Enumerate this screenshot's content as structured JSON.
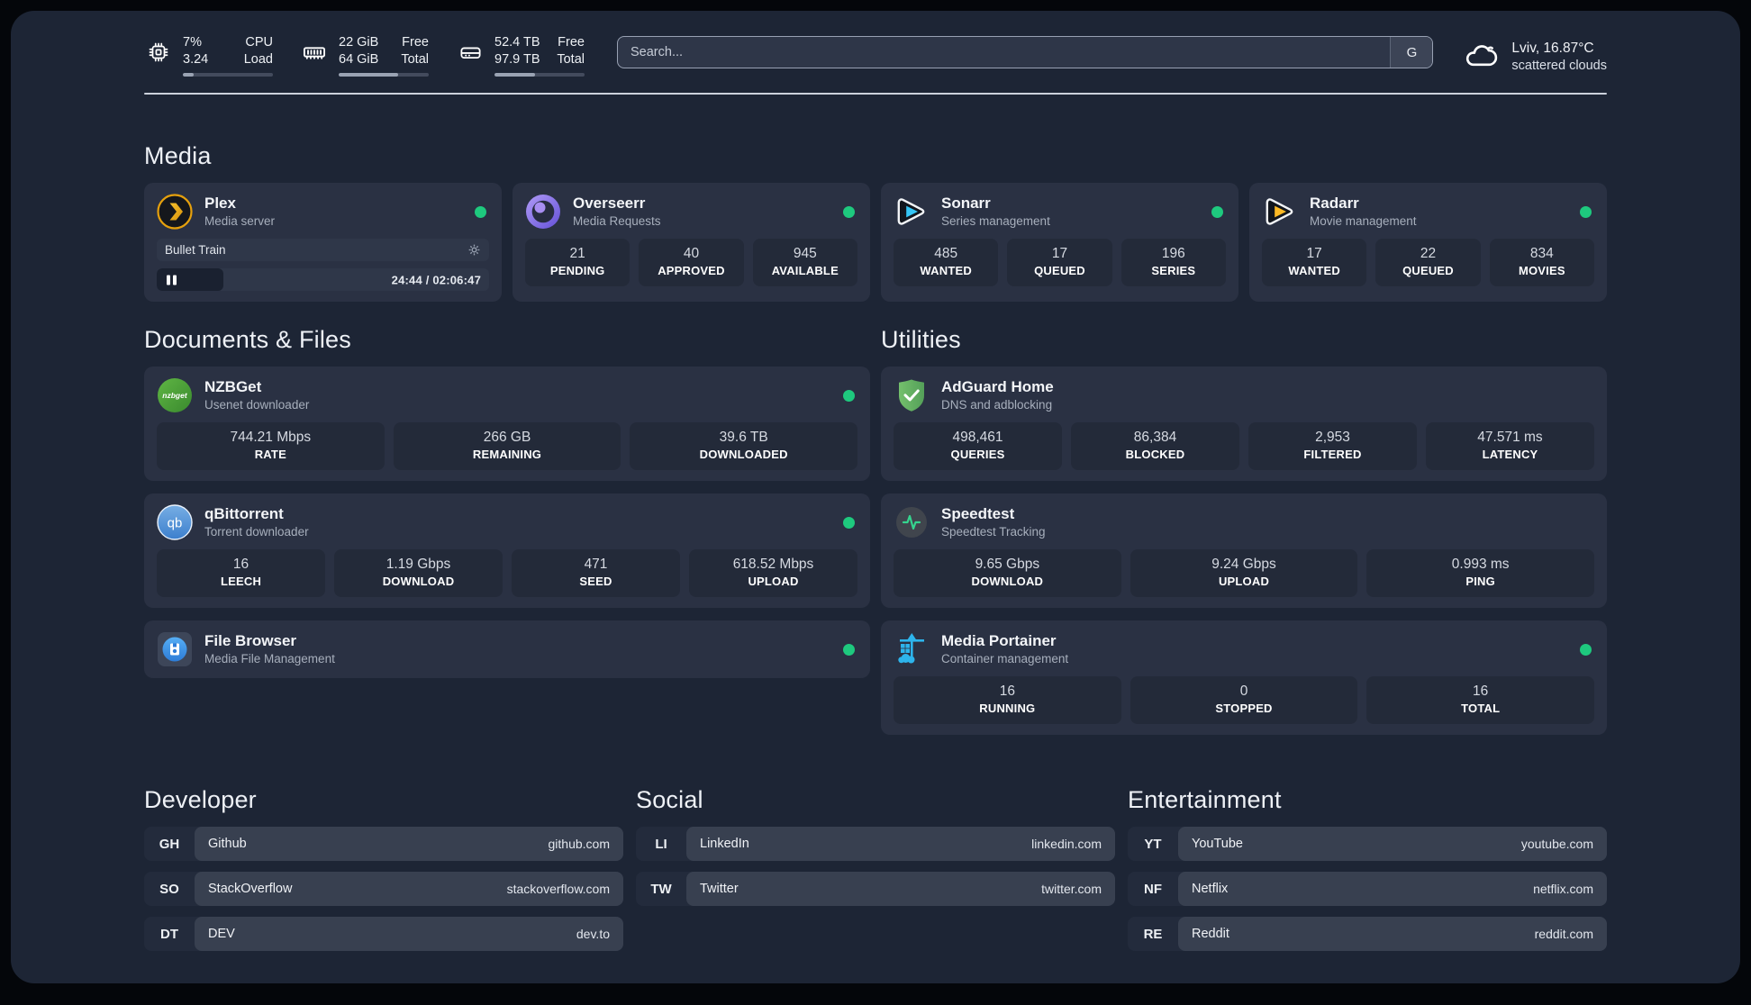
{
  "header": {
    "stats": [
      {
        "id": "cpu",
        "value_top": "7%",
        "value_bottom": "3.24",
        "label_top": "CPU",
        "label_bottom": "Load",
        "progress": "12%"
      },
      {
        "id": "memory",
        "value_top": "22 GiB",
        "value_bottom": "64 GiB",
        "label_top": "Free",
        "label_bottom": "Total",
        "progress": "66%"
      },
      {
        "id": "disk",
        "value_top": "52.4 TB",
        "value_bottom": "97.9 TB",
        "label_top": "Free",
        "label_bottom": "Total",
        "progress": "45%"
      }
    ],
    "search": {
      "placeholder": "Search...",
      "engine_label": "G"
    },
    "weather": {
      "location": "Lviv, 16.87°C",
      "condition": "scattered clouds"
    }
  },
  "media": {
    "title": "Media",
    "plex": {
      "name": "Plex",
      "desc": "Media server",
      "player": {
        "track": "Bullet Train",
        "time": "24:44 / 02:06:47",
        "elapsed": "20%"
      }
    },
    "overseerr": {
      "name": "Overseerr",
      "desc": "Media Requests",
      "stats": [
        {
          "value": "21",
          "label": "PENDING"
        },
        {
          "value": "40",
          "label": "APPROVED"
        },
        {
          "value": "945",
          "label": "AVAILABLE"
        }
      ]
    },
    "sonarr": {
      "name": "Sonarr",
      "desc": "Series management",
      "stats": [
        {
          "value": "485",
          "label": "WANTED"
        },
        {
          "value": "17",
          "label": "QUEUED"
        },
        {
          "value": "196",
          "label": "SERIES"
        }
      ]
    },
    "radarr": {
      "name": "Radarr",
      "desc": "Movie management",
      "stats": [
        {
          "value": "17",
          "label": "WANTED"
        },
        {
          "value": "22",
          "label": "QUEUED"
        },
        {
          "value": "834",
          "label": "MOVIES"
        }
      ]
    }
  },
  "documents": {
    "title": "Documents & Files",
    "nzbget": {
      "name": "NZBGet",
      "desc": "Usenet downloader",
      "stats": [
        {
          "value": "744.21 Mbps",
          "label": "RATE"
        },
        {
          "value": "266 GB",
          "label": "REMAINING"
        },
        {
          "value": "39.6 TB",
          "label": "DOWNLOADED"
        }
      ]
    },
    "qbittorrent": {
      "name": "qBittorrent",
      "desc": "Torrent downloader",
      "stats": [
        {
          "value": "16",
          "label": "LEECH"
        },
        {
          "value": "1.19 Gbps",
          "label": "DOWNLOAD"
        },
        {
          "value": "471",
          "label": "SEED"
        },
        {
          "value": "618.52 Mbps",
          "label": "UPLOAD"
        }
      ]
    },
    "filebrowser": {
      "name": "File Browser",
      "desc": "Media File Management"
    }
  },
  "utilities": {
    "title": "Utilities",
    "adguard": {
      "name": "AdGuard Home",
      "desc": "DNS and adblocking",
      "stats": [
        {
          "value": "498,461",
          "label": "QUERIES"
        },
        {
          "value": "86,384",
          "label": "BLOCKED"
        },
        {
          "value": "2,953",
          "label": "FILTERED"
        },
        {
          "value": "47.571 ms",
          "label": "LATENCY"
        }
      ]
    },
    "speedtest": {
      "name": "Speedtest",
      "desc": "Speedtest Tracking",
      "stats": [
        {
          "value": "9.65 Gbps",
          "label": "DOWNLOAD"
        },
        {
          "value": "9.24 Gbps",
          "label": "UPLOAD"
        },
        {
          "value": "0.993 ms",
          "label": "PING"
        }
      ]
    },
    "portainer": {
      "name": "Media Portainer",
      "desc": "Container management",
      "stats": [
        {
          "value": "16",
          "label": "RUNNING"
        },
        {
          "value": "0",
          "label": "STOPPED"
        },
        {
          "value": "16",
          "label": "TOTAL"
        }
      ]
    }
  },
  "links": {
    "developer": {
      "title": "Developer",
      "items": [
        {
          "abbr": "GH",
          "name": "Github",
          "url": "github.com"
        },
        {
          "abbr": "SO",
          "name": "StackOverflow",
          "url": "stackoverflow.com"
        },
        {
          "abbr": "DT",
          "name": "DEV",
          "url": "dev.to"
        }
      ]
    },
    "social": {
      "title": "Social",
      "items": [
        {
          "abbr": "LI",
          "name": "LinkedIn",
          "url": "linkedin.com"
        },
        {
          "abbr": "TW",
          "name": "Twitter",
          "url": "twitter.com"
        }
      ]
    },
    "entertainment": {
      "title": "Entertainment",
      "items": [
        {
          "abbr": "YT",
          "name": "YouTube",
          "url": "youtube.com"
        },
        {
          "abbr": "NF",
          "name": "Netflix",
          "url": "netflix.com"
        },
        {
          "abbr": "RE",
          "name": "Reddit",
          "url": "reddit.com"
        }
      ]
    }
  },
  "colors": {
    "status_online": "#1ec97e"
  }
}
